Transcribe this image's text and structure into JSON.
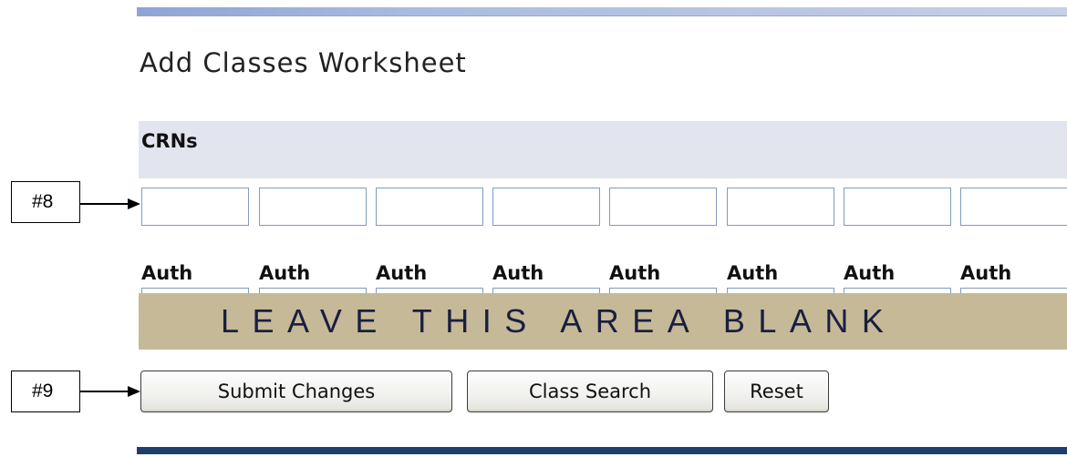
{
  "page": {
    "title": "Add Classes Worksheet"
  },
  "crns": {
    "header": "CRNs",
    "fields": [
      {
        "value": ""
      },
      {
        "value": ""
      },
      {
        "value": ""
      },
      {
        "value": ""
      },
      {
        "value": ""
      },
      {
        "value": ""
      },
      {
        "value": ""
      },
      {
        "value": ""
      }
    ]
  },
  "auth": {
    "labels": [
      "Auth",
      "Auth",
      "Auth",
      "Auth",
      "Auth",
      "Auth",
      "Auth",
      "Auth"
    ]
  },
  "overlay": {
    "text": "LEAVE THIS AREA BLANK",
    "color": "#c6b998"
  },
  "callouts": [
    {
      "label": "#8"
    },
    {
      "label": "#9"
    }
  ],
  "buttons": {
    "submit": "Submit Changes",
    "class_search": "Class Search",
    "reset": "Reset"
  },
  "colors": {
    "header_bg": "#e3e5ee",
    "input_border": "#7f9db9",
    "bottom_rule": "#1e3f6e"
  }
}
